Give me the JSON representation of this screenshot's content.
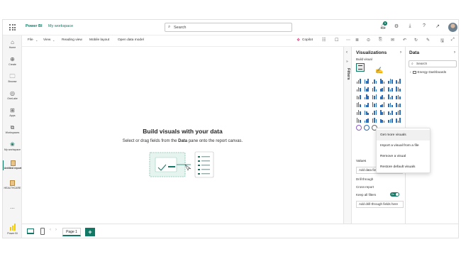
{
  "app": {
    "brand": "Power BI",
    "workspace": "My workspace",
    "search_placeholder": "Search",
    "notification_count": "5"
  },
  "rail": [
    {
      "label": "Home",
      "icon": "home-icon"
    },
    {
      "label": "Create",
      "icon": "plus-circle-icon"
    },
    {
      "label": "Browse",
      "icon": "folder-icon"
    },
    {
      "label": "OneLake",
      "icon": "onelake-icon"
    },
    {
      "label": "Apps",
      "icon": "apps-icon"
    },
    {
      "label": "Workspaces",
      "icon": "workspaces-icon"
    },
    {
      "label": "My workspace",
      "icon": "my-workspace-icon"
    },
    {
      "label": "Untitled report",
      "icon": "report-icon"
    },
    {
      "label": "HEALTHCARE",
      "icon": "report-icon"
    },
    {
      "label": "...",
      "icon": "more-icon"
    },
    {
      "label": "Power BI",
      "icon": "power-bi-logo"
    }
  ],
  "ribbon": {
    "file": "File",
    "view": "View",
    "reading_view": "Reading view",
    "mobile_layout": "Mobile layout",
    "open_data_model": "Open data model",
    "copilot": "Copilot"
  },
  "canvas": {
    "title": "Build visuals with your data",
    "subtitle_pre": "Select or drag fields from the ",
    "subtitle_bold": "Data",
    "subtitle_post": " pane onto the report canvas."
  },
  "pagebar": {
    "page_tab": "Page 1",
    "add": "+"
  },
  "filters": {
    "label": "Filters"
  },
  "viz_pane": {
    "title": "Visualizations",
    "build_visual": "Build visual",
    "values_label": "Values",
    "add_data_fields": "Add data fields here",
    "drill_through": "Drill through",
    "cross_report": "Cross-report",
    "keep_all_filters": "Keep all filters",
    "toggle_state": "On",
    "add_drill_through": "Add drill-through fields here"
  },
  "data_pane": {
    "title": "Data",
    "search_placeholder": "Search",
    "table": "Energy Dashboards"
  },
  "context_menu": {
    "items": [
      "Get more visuals",
      "Import a visual from a file",
      "Remove a visual",
      "Restore default visuals"
    ]
  },
  "colors": {
    "brand": "#117865",
    "chart_blue": "#2b6cb5"
  }
}
